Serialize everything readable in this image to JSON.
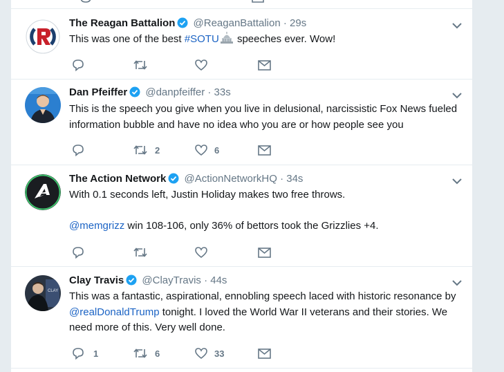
{
  "tweets": [
    {
      "name": "The Reagan Battalion",
      "handle": "@ReaganBattalion",
      "time": "29s",
      "text_before": "This was one of the best ",
      "hashtag": "#SOTU",
      "text_after": " speeches ever. Wow!",
      "replies": "",
      "retweets": "",
      "likes": ""
    },
    {
      "name": "Dan Pfeiffer",
      "handle": "@danpfeiffer",
      "time": "33s",
      "text": "This is the speech you give when you live in delusional, narcissistic Fox News fueled information bubble and have no idea who you are or how people see you",
      "replies": "",
      "retweets": "2",
      "likes": "6"
    },
    {
      "name": "The Action Network",
      "handle": "@ActionNetworkHQ",
      "time": "34s",
      "text_line1": "With 0.1 seconds left, Justin Holiday makes two free throws.",
      "mention": "@memgrizz",
      "text_line2": " win 108-106, only 36% of bettors took the Grizzlies +4.",
      "replies": "",
      "retweets": "",
      "likes": ""
    },
    {
      "name": "Clay Travis",
      "handle": "@ClayTravis",
      "time": "44s",
      "text_before": "This was a fantastic, aspirational, ennobling speech laced with historic resonance by ",
      "mention": "@realDonaldTrump",
      "text_after": " tonight. I loved the World War II veterans and their stories. We need more of this. Very well done.",
      "replies": "1",
      "retweets": "6",
      "likes": "33"
    }
  ],
  "separator": "·",
  "avatar_labels": {
    "action_network": "A",
    "clay_sign": "CLAY"
  },
  "colors": {
    "verified": "#1da1f2",
    "link": "#1b63c4",
    "secondary_text": "#657786",
    "border": "#e6ecf0",
    "background": "#e6ecf0"
  },
  "icons": [
    "reply-icon",
    "retweet-icon",
    "like-icon",
    "direct-message-icon",
    "verified-badge-icon",
    "chevron-down-icon",
    "capitol-emoji"
  ]
}
